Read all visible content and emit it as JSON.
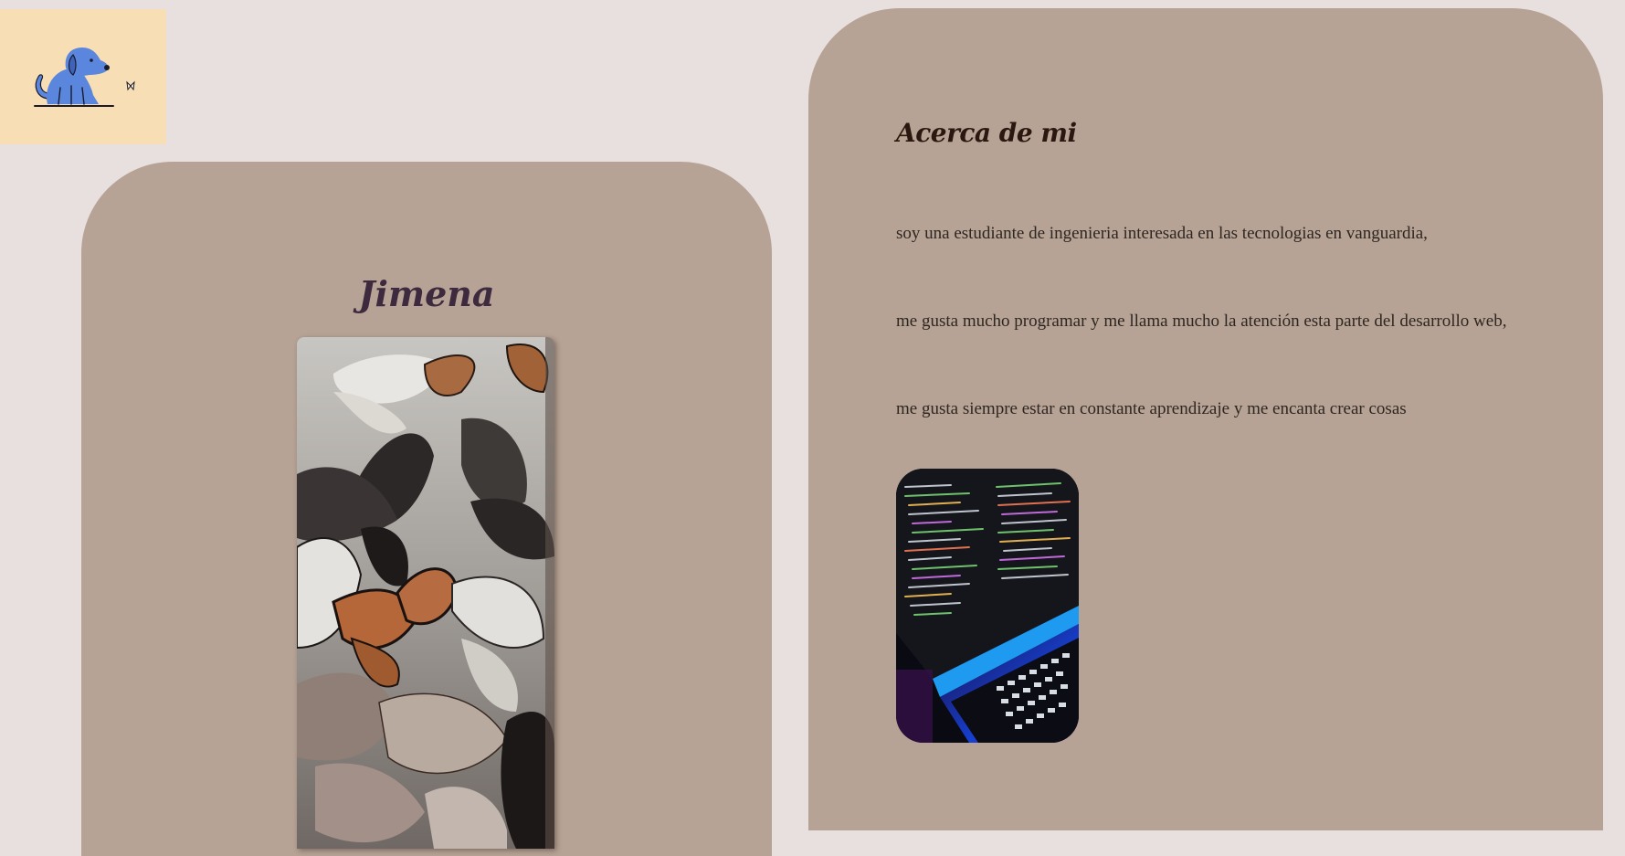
{
  "logo": {
    "icon": "dog-butterfly-logo"
  },
  "profile": {
    "name": "Jimena",
    "photo": {
      "icon": "butterflies-photo"
    }
  },
  "about": {
    "title": "Acerca de mi",
    "paragraphs": [
      "soy una estudiante de ingenieria interesada en las tecnologias en vanguardia,",
      "me gusta mucho programar y me llama mucho la atención esta parte del desarrollo web,",
      "me gusta siempre estar en constante aprendizaje y me encanta crear cosas"
    ],
    "photo": {
      "icon": "laptop-code-photo"
    }
  },
  "colors": {
    "background": "#e8e0df",
    "card": "#b6a395",
    "logo_bg": "#f7deb5",
    "name_text": "#3e2a3e",
    "dog_blue": "#5b86dd"
  }
}
